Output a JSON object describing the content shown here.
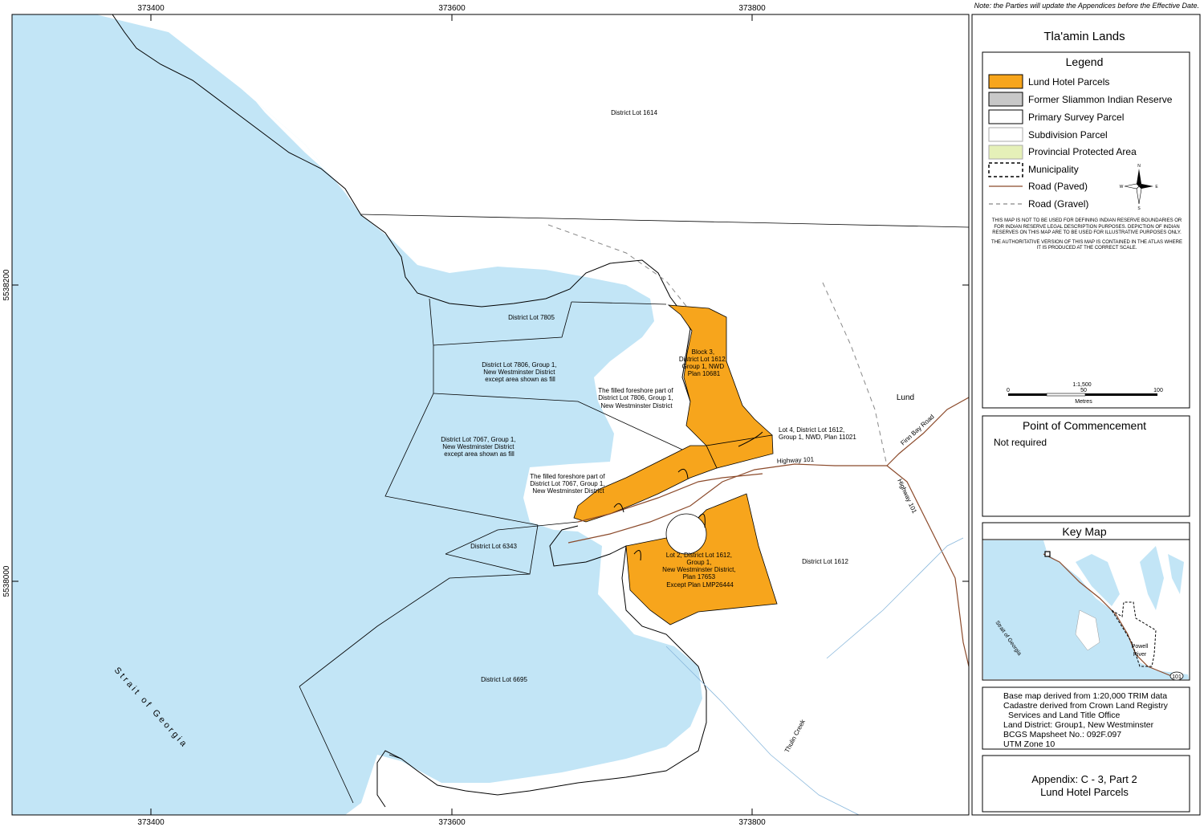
{
  "note": "Note:  the Parties will update the Appendices before the Effective Date.",
  "title": "Tla'amin Lands",
  "legend": {
    "heading": "Legend",
    "items": [
      {
        "label": "Lund Hotel Parcels",
        "kind": "fill",
        "color": "#F7A51C"
      },
      {
        "label": "Former Sliammon Indian Reserve",
        "kind": "fill",
        "color": "#C8C8C8"
      },
      {
        "label": "Primary Survey Parcel",
        "kind": "fill",
        "color": "#FFFFFF"
      },
      {
        "label": "Subdivision Parcel",
        "kind": "fill",
        "color": "#FFFFFF"
      },
      {
        "label": "Provincial Protected Area",
        "kind": "fill",
        "color": "#E5F0B8"
      },
      {
        "label": "Municipality",
        "kind": "dashed-box",
        "color": "#000000"
      },
      {
        "label": "Road (Paved)",
        "kind": "line",
        "color": "#8B4A2B"
      },
      {
        "label": "Road (Gravel)",
        "kind": "dashed-line",
        "color": "#888888"
      }
    ],
    "disclaimer1": "THIS MAP IS NOT TO BE USED FOR DEFINING INDIAN RESERVE BOUNDARIES OR FOR INDIAN RESERVE LEGAL DESCRIPTION PURPOSES.  DEPICTION OF INDIAN RESERVES ON THIS MAP ARE TO BE USED FOR ILLUSTRATIVE PURPOSES ONLY.",
    "disclaimer2": "THE AUTHORITATIVE VERSION OF THIS MAP IS CONTAINED IN THE ATLAS WHERE IT IS PRODUCED AT THE CORRECT SCALE.",
    "scale": {
      "ratio": "1:1,500",
      "ticks": [
        "0",
        "50",
        "100"
      ],
      "unit": "Metres"
    },
    "compass": [
      "N",
      "E",
      "S",
      "W"
    ]
  },
  "commencement": {
    "heading": "Point of Commencement",
    "text": "Not required"
  },
  "keymap": {
    "heading": "Key Map",
    "labels": {
      "strait": "Strait of Georgia",
      "powell": "Powell",
      "river": "River",
      "highway": "101"
    }
  },
  "info": [
    "Base map derived from 1:20,000 TRIM data",
    "Cadastre derived from Crown Land Registry",
    "  Services and Land Title Office",
    "Land District: Group1, New Westminster",
    "BCGS Mapsheet No.: 092F.097",
    "UTM Zone 10"
  ],
  "appendix": {
    "line1": "Appendix:  C - 3, Part 2",
    "line2": "Lund Hotel Parcels"
  },
  "grid": {
    "x_labels": [
      "373400",
      "373600",
      "373800"
    ],
    "y_labels": [
      "5538200",
      "5538000"
    ]
  },
  "map_labels": {
    "dl1614": "District Lot 1614",
    "dl7805": "District Lot 7805",
    "dl7806": [
      "District Lot 7806, Group 1,",
      "New Westminster District",
      "except area shown as fill"
    ],
    "fill7806": [
      "The filled foreshore part of",
      "District Lot 7806, Group 1,",
      "New Westminster District"
    ],
    "block3": [
      "Block 3,",
      "District Lot 1612,",
      "Group 1, NWD",
      "Plan 10681"
    ],
    "lund": "Lund",
    "lot4": [
      "Lot 4, District Lot 1612,",
      "Group 1, NWD, Plan 11021"
    ],
    "firn": "Finn Bay Road",
    "dl7067": [
      "District Lot 7067, Group 1,",
      "New Westminster District",
      "except area shown as fill"
    ],
    "hwy101": "Highway 101",
    "hwy101b": "Highway 101",
    "fill7067": [
      "The filled foreshore part of",
      "District Lot 7067, Group 1,",
      "New Westminster District"
    ],
    "dl6343": "District Lot 6343",
    "lot2": [
      "Lot 2, District Lot 1612,",
      "Group 1,",
      "New Westminster District,",
      "Plan 17653",
      "Except Plan LMP26444"
    ],
    "dl1612": "District Lot 1612",
    "dl6695": "District Lot 6695",
    "strait": "Strait of Georgia",
    "thulin": "Thulin Creek"
  }
}
